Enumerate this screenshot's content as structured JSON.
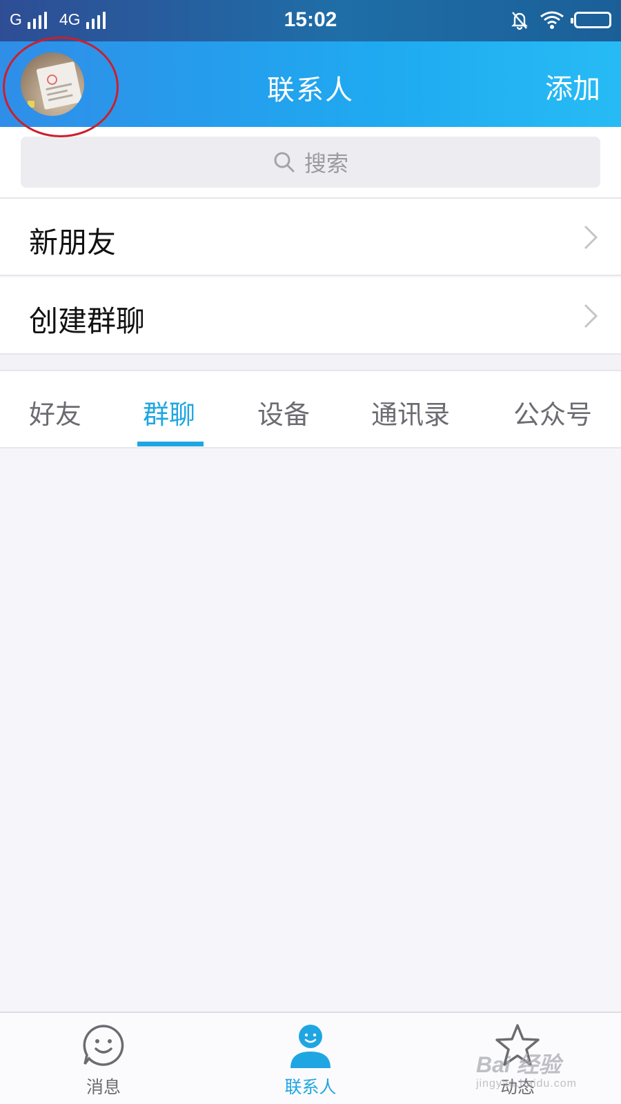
{
  "status_bar": {
    "carrier_1": "G",
    "carrier_2": "4G",
    "time": "15:02",
    "icons": [
      "signal-icon",
      "signal-icon",
      "bell-muted-icon",
      "wifi-icon",
      "battery-icon"
    ]
  },
  "header": {
    "title": "联系人",
    "add_label": "添加",
    "avatar_icon": "profile-photo"
  },
  "search": {
    "placeholder": "搜索",
    "icon": "search-icon"
  },
  "list": [
    {
      "label": "新朋友",
      "icon": "chevron-right-icon"
    },
    {
      "label": "创建群聊",
      "icon": "chevron-right-icon"
    }
  ],
  "tabs": [
    {
      "label": "好友",
      "active": false
    },
    {
      "label": "群聊",
      "active": true
    },
    {
      "label": "设备",
      "active": false
    },
    {
      "label": "通讯录",
      "active": false
    },
    {
      "label": "公众号",
      "active": false
    }
  ],
  "bottom_nav": [
    {
      "label": "消息",
      "icon": "smiley-chat-icon",
      "active": false
    },
    {
      "label": "联系人",
      "icon": "person-icon",
      "active": true
    },
    {
      "label": "动态",
      "icon": "star-icon",
      "active": false
    }
  ],
  "watermark": {
    "text": "Bai 经验",
    "url": "jingyan.baidu.com"
  },
  "colors": {
    "accent": "#1fa6e2",
    "header_start": "#2f8ee8",
    "header_end": "#27bbf5",
    "annotation": "#cc1f2b"
  }
}
